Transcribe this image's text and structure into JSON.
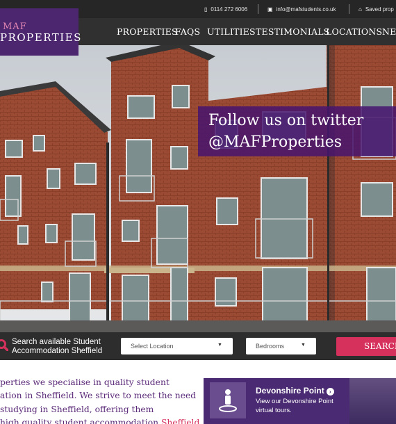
{
  "topbar": {
    "phone": "0114 272 6006",
    "email": "info@mafstudents.co.uk",
    "saved": "Saved prop",
    "phone_icon": "phone-icon",
    "email_icon": "laptop-icon",
    "saved_icon": "home-icon"
  },
  "logo": {
    "line1": "MAF",
    "line2": "PROPERTIES"
  },
  "nav": {
    "items": [
      "PROPERTIES",
      "FAQS",
      "UTILITIES",
      "TESTIMONIALS",
      "LOCATIONS",
      "NEV"
    ]
  },
  "hero": {
    "twitter_line1": "Follow us on twitter",
    "twitter_line2": "@MAFProperties"
  },
  "search": {
    "label_line1": "Search available Student",
    "label_line2": "Accommodation Sheffield",
    "location_placeholder": "Select Location",
    "bedrooms_placeholder": "Bedrooms",
    "button": "SEARCH",
    "caret": "▼"
  },
  "intro": {
    "line1": "perties we specialise in quality student",
    "line2": "ation in Sheffield. We strive to meet the need",
    "line3": "studying in Sheffield, offering them",
    "line4_a": "high quality student accommodation ",
    "line4_b": "Sheffield"
  },
  "promo": {
    "title": "Devonshire Point",
    "arrow": "›",
    "desc_line1": "View our Devonshire Point",
    "desc_line2": "virtual tours."
  },
  "colors": {
    "brand_purple": "#4d2670",
    "accent_pink": "#d6315c",
    "dark_bar": "#262626"
  }
}
